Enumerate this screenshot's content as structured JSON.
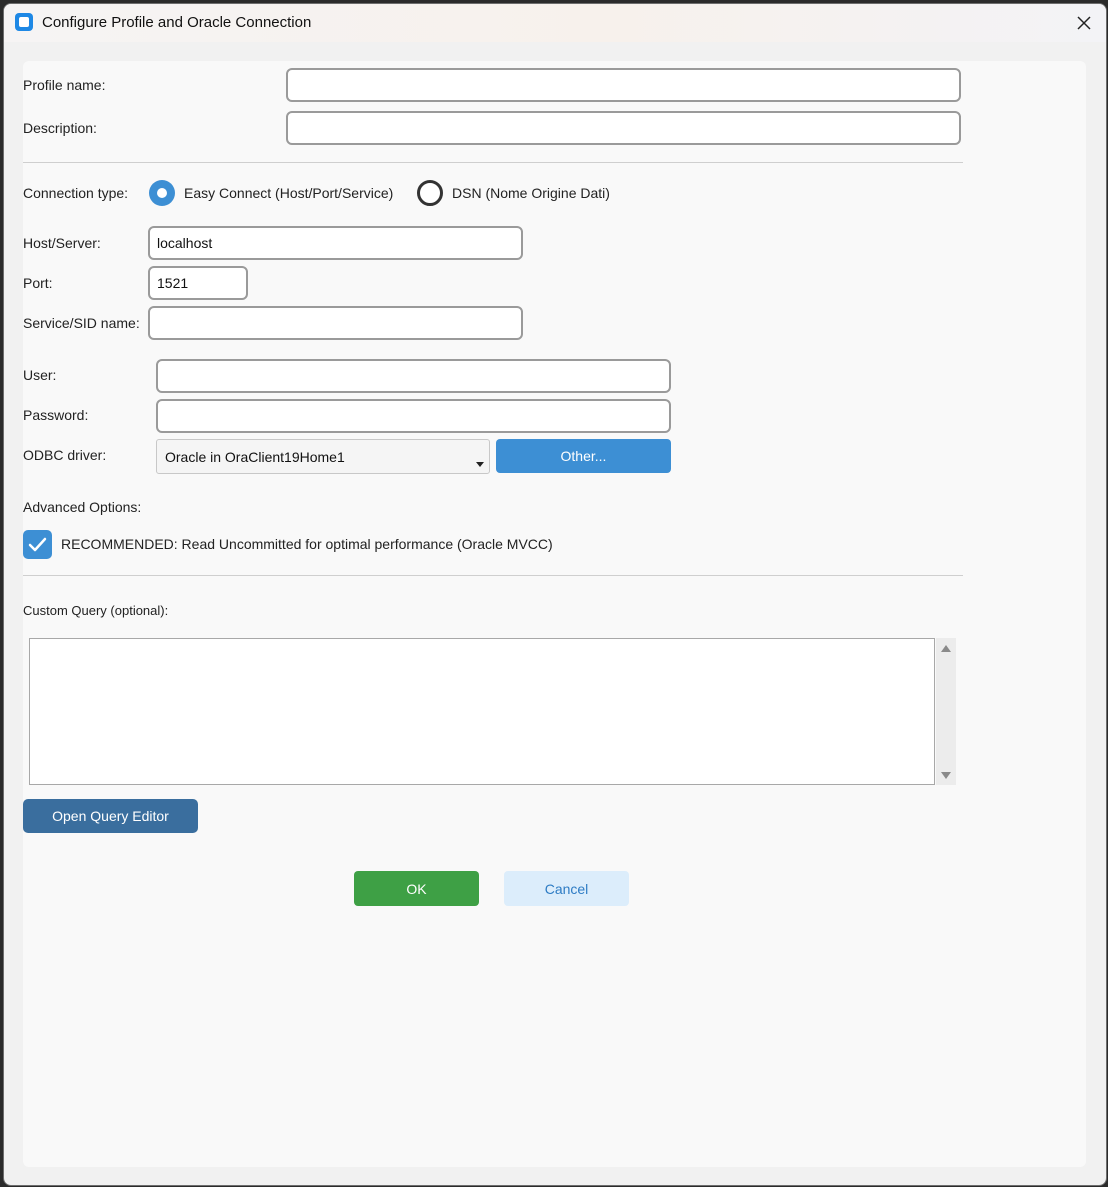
{
  "window": {
    "title": "Configure Profile and Oracle Connection"
  },
  "profile": {
    "name_label": "Profile name:",
    "name_value": "",
    "description_label": "Description:",
    "description_value": ""
  },
  "connection": {
    "type_label": "Connection type:",
    "easy_connect_label": "Easy Connect (Host/Port/Service)",
    "dsn_label": "DSN (Nome Origine Dati)",
    "selected": "easy_connect"
  },
  "easy": {
    "host_label": "Host/Server:",
    "host_value": "localhost",
    "port_label": "Port:",
    "port_value": "1521",
    "service_label": "Service/SID name:",
    "service_value": ""
  },
  "credentials": {
    "user_label": "User:",
    "user_value": "",
    "password_label": "Password:",
    "password_value": "",
    "driver_label": "ODBC driver:",
    "driver_value": "Oracle in OraClient19Home1",
    "other_label": "Other..."
  },
  "advanced": {
    "title": "Advanced Options:",
    "read_uncommitted_label": "RECOMMENDED: Read Uncommitted for optimal performance (Oracle MVCC)",
    "read_uncommitted_checked": true
  },
  "query": {
    "label": "Custom Query (optional):",
    "value": "",
    "editor_button": "Open Query Editor"
  },
  "actions": {
    "ok": "OK",
    "cancel": "Cancel"
  },
  "colors": {
    "accent": "#3d8fd4",
    "ok": "#3ea045",
    "cancel": "#dcedfb",
    "editor": "#3a6e9e"
  }
}
